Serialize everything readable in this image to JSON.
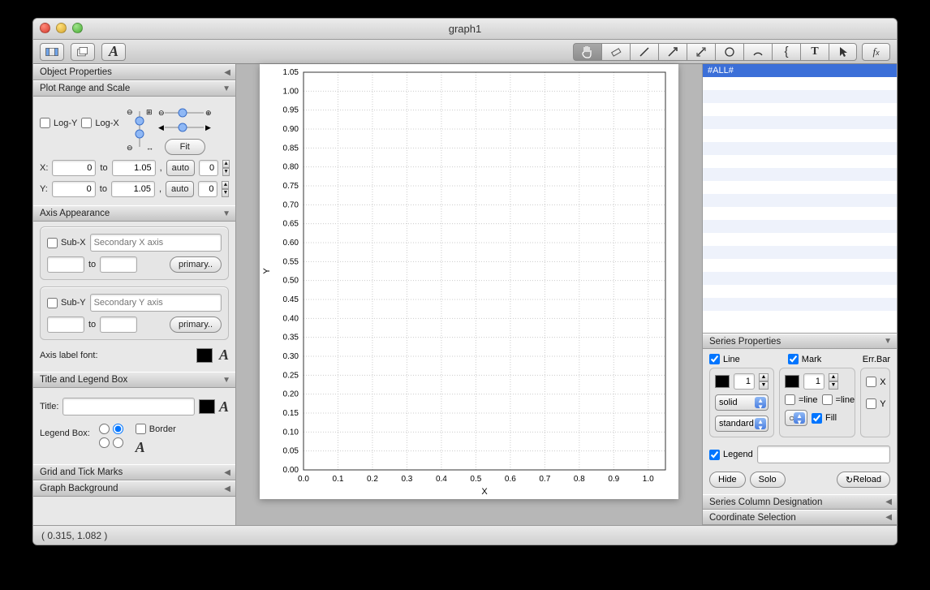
{
  "window": {
    "title": "graph1"
  },
  "toolbar": {
    "right_icons": [
      "pan",
      "eraser",
      "line",
      "arrow-ne",
      "arrow-both",
      "circle",
      "arc",
      "brace",
      "text",
      "pointer",
      "fx"
    ]
  },
  "left": {
    "objprops": "Object Properties",
    "range": {
      "header": "Plot Range and Scale",
      "logy": "Log-Y",
      "logx": "Log-X",
      "fit": "Fit",
      "X": "X:",
      "Y": "Y:",
      "to": "to",
      "auto": "auto",
      "x_from": "0",
      "x_to": "1.05",
      "x_extra": "0",
      "y_from": "0",
      "y_to": "1.05",
      "y_extra": "0"
    },
    "axis": {
      "header": "Axis Appearance",
      "subx": "Sub-X",
      "subx_ph": "Secondary X axis",
      "suby": "Sub-Y",
      "suby_ph": "Secondary Y axis",
      "to": "to",
      "primary": "primary..",
      "labelfont": "Axis label font:"
    },
    "title": {
      "header": "Title and Legend Box",
      "title": "Title:",
      "legend": "Legend Box:",
      "border": "Border"
    },
    "grid": "Grid and Tick Marks",
    "bg": "Graph Background"
  },
  "right": {
    "all": "#ALL#",
    "sp": {
      "header": "Series Properties",
      "line": "Line",
      "mark": "Mark",
      "errbar": "Err.Bar",
      "lw": "1",
      "mw": "1",
      "solid": "solid",
      "standard": "standard",
      "eqline": "=line",
      "fill": "Fill",
      "X": "X",
      "Y": "Y",
      "legend": "Legend",
      "hide": "Hide",
      "solo": "Solo",
      "reload": "Reload"
    },
    "scd": "Series Column Designation",
    "coord": "Coordinate Selection"
  },
  "status": {
    "coords": "( 0.315,   1.082 )"
  },
  "chart_data": {
    "type": "scatter",
    "title": "",
    "xlabel": "X",
    "ylabel": "Y",
    "xlim": [
      0,
      1.05
    ],
    "ylim": [
      0,
      1.05
    ],
    "xticks": [
      0.0,
      0.1,
      0.2,
      0.3,
      0.4,
      0.5,
      0.6,
      0.7,
      0.8,
      0.9,
      1.0
    ],
    "yticks": [
      0.0,
      0.05,
      0.1,
      0.15,
      0.2,
      0.25,
      0.3,
      0.35,
      0.4,
      0.45,
      0.5,
      0.55,
      0.6,
      0.65,
      0.7,
      0.75,
      0.8,
      0.85,
      0.9,
      0.95,
      1.0,
      1.05
    ],
    "series": []
  }
}
